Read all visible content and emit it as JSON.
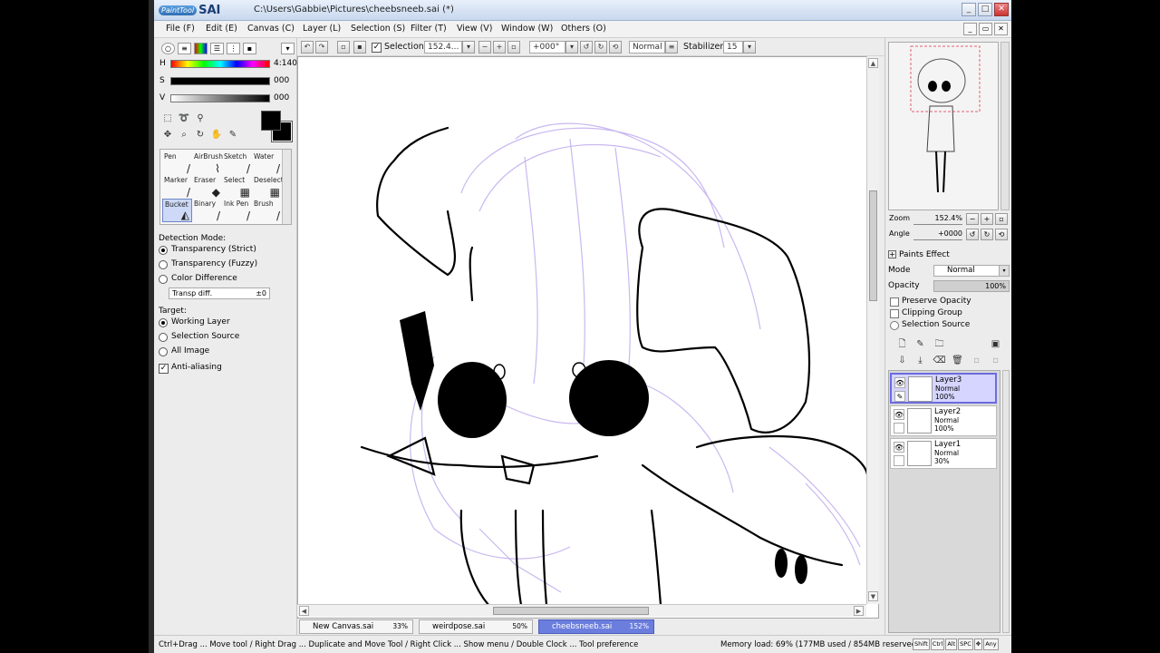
{
  "window": {
    "logo_badge": "PaintTool",
    "logo_text": "SAI",
    "title": "C:\\Users\\Gabbie\\Pictures\\cheebsneeb.sai (*)",
    "min": "_",
    "max": "□",
    "close": "✕"
  },
  "menu": {
    "items": [
      "File (F)",
      "Edit (E)",
      "Canvas (C)",
      "Layer (L)",
      "Selection (S)",
      "Filter (T)",
      "View (V)",
      "Window (W)",
      "Others (O)"
    ]
  },
  "toolbar": {
    "selection_label": "Selection",
    "zoom_value": "152.4...",
    "rotation_value": "+000°",
    "blend_mode": "Normal",
    "stabilizer_label": "Stabilizer",
    "stabilizer_value": "15"
  },
  "color": {
    "h_label": "H",
    "h_value": "4:140",
    "s_label": "S",
    "s_value": "000",
    "v_label": "V",
    "v_value": "000",
    "foreground": "#000000"
  },
  "tools": {
    "brushes": [
      {
        "name": "Pen",
        "glyph": "/"
      },
      {
        "name": "AirBrush",
        "glyph": "⌇"
      },
      {
        "name": "Sketch",
        "glyph": "/"
      },
      {
        "name": "Water",
        "glyph": "/"
      },
      {
        "name": "Marker",
        "glyph": "/"
      },
      {
        "name": "Eraser",
        "glyph": "◆"
      },
      {
        "name": "Select",
        "glyph": "▦"
      },
      {
        "name": "Deselect",
        "glyph": "▦"
      },
      {
        "name": "Bucket",
        "glyph": "◭"
      },
      {
        "name": "Binary",
        "glyph": "/"
      },
      {
        "name": "Ink Pen",
        "glyph": "/"
      },
      {
        "name": "Brush",
        "glyph": "/"
      }
    ],
    "selected_brush": "Bucket"
  },
  "options": {
    "detection_mode_label": "Detection Mode:",
    "detection_modes": [
      "Transparency (Strict)",
      "Transparency (Fuzzy)",
      "Color Difference"
    ],
    "detection_selected": "Transparency (Strict)",
    "transp_label": "Transp diff.",
    "transp_value": "±0",
    "target_label": "Target:",
    "targets": [
      "Working Layer",
      "Selection Source",
      "All Image"
    ],
    "target_selected": "Working Layer",
    "antialias_label": "Anti-aliasing",
    "antialias_checked": true
  },
  "navigator": {
    "zoom_label": "Zoom",
    "zoom_value": "152.4%",
    "angle_label": "Angle",
    "angle_value": "+0000"
  },
  "layer_props": {
    "paints_effect_label": "Paints Effect",
    "mode_label": "Mode",
    "mode_value": "Normal",
    "opacity_label": "Opacity",
    "opacity_value": "100%",
    "preserve_opacity": "Preserve Opacity",
    "clipping_group": "Clipping Group",
    "selection_source": "Selection Source"
  },
  "layers": [
    {
      "name": "Layer3",
      "mode": "Normal",
      "opacity": "100%",
      "selected": true
    },
    {
      "name": "Layer2",
      "mode": "Normal",
      "opacity": "100%",
      "selected": false
    },
    {
      "name": "Layer1",
      "mode": "Normal",
      "opacity": "30%",
      "selected": false
    }
  ],
  "tabs": [
    {
      "name": "New Canvas.sai",
      "zoom": "33%",
      "active": false
    },
    {
      "name": "weirdpose.sai",
      "zoom": "50%",
      "active": false
    },
    {
      "name": "cheebsneeb.sai",
      "zoom": "152%",
      "active": true
    }
  ],
  "status": {
    "hint": "Ctrl+Drag ... Move tool / Right Drag ... Duplicate and Move Tool / Right Click ... Show menu / Double Clock ... Tool preference",
    "memory": "Memory load: 69% (177MB used / 854MB reserved)",
    "keys": [
      "Shift",
      "Ctrl",
      "Alt",
      "SPC",
      "✥",
      "Any"
    ]
  },
  "colors": {
    "sketch_purple": "#c9b8f0",
    "selection_blue": "#6b7ddd",
    "layer_sel_border": "#6b6be0"
  }
}
